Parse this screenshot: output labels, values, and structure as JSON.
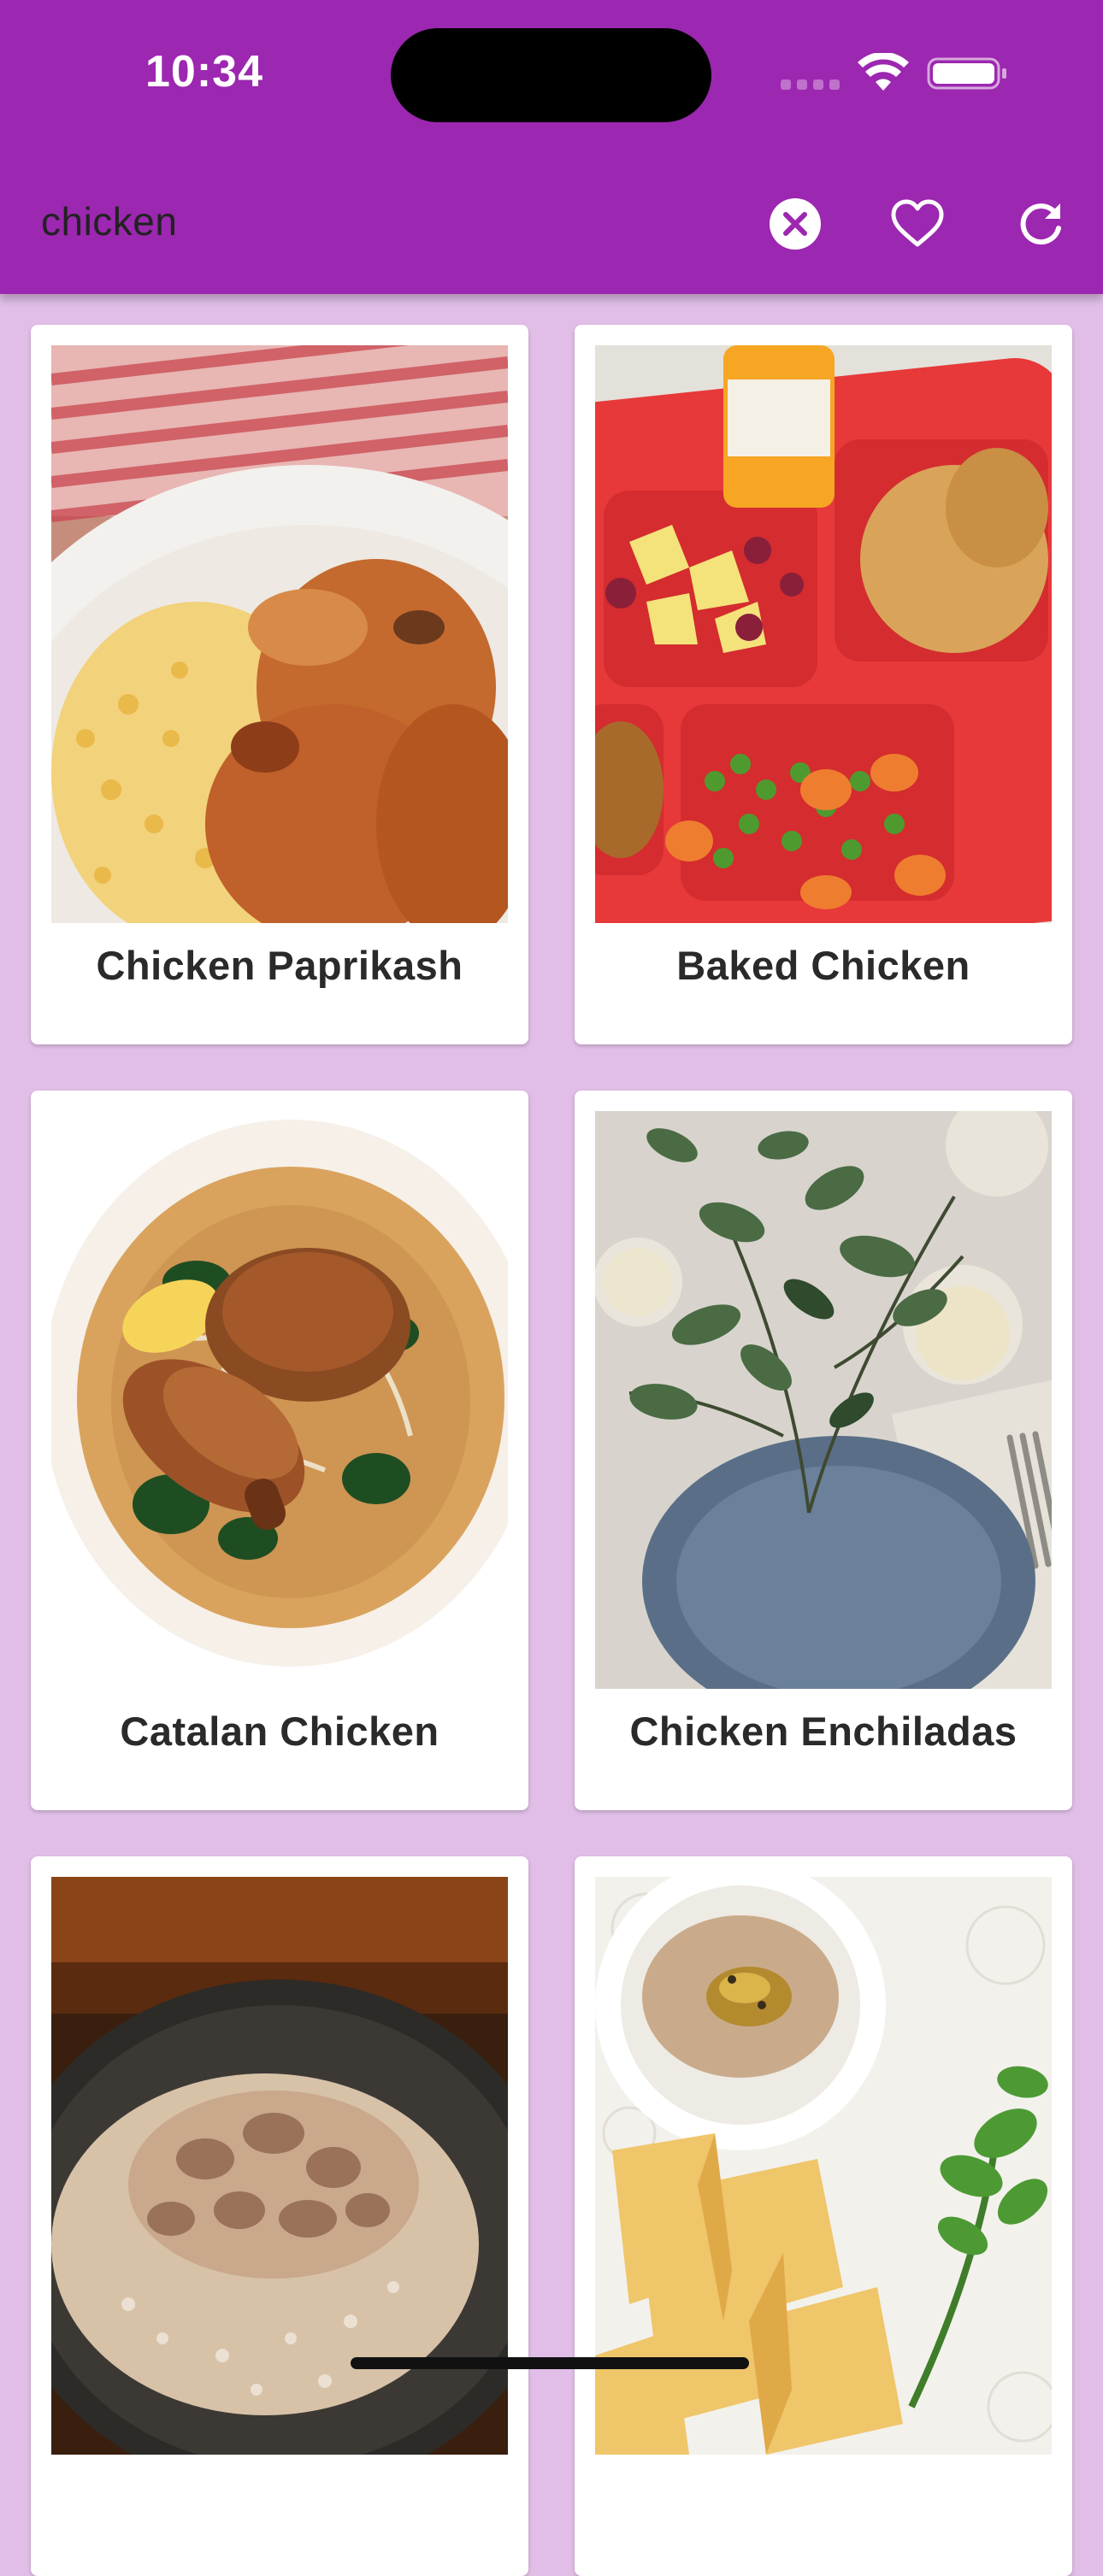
{
  "status_bar": {
    "time": "10:34",
    "icons": [
      "signal-icon",
      "wifi-icon",
      "battery-icon"
    ]
  },
  "search": {
    "value": "chicken",
    "placeholder": ""
  },
  "toolbar": {
    "icons": [
      "clear-icon",
      "heart-icon",
      "refresh-icon"
    ]
  },
  "colors": {
    "app_bar": "#9C27B0",
    "background": "#E1BEE7",
    "card": "#FFFFFF"
  },
  "recipes": [
    {
      "title": "Chicken Paprikash"
    },
    {
      "title": "Baked Chicken"
    },
    {
      "title": "Catalan Chicken"
    },
    {
      "title": "Chicken Enchiladas"
    },
    {
      "title": ""
    },
    {
      "title": ""
    }
  ]
}
